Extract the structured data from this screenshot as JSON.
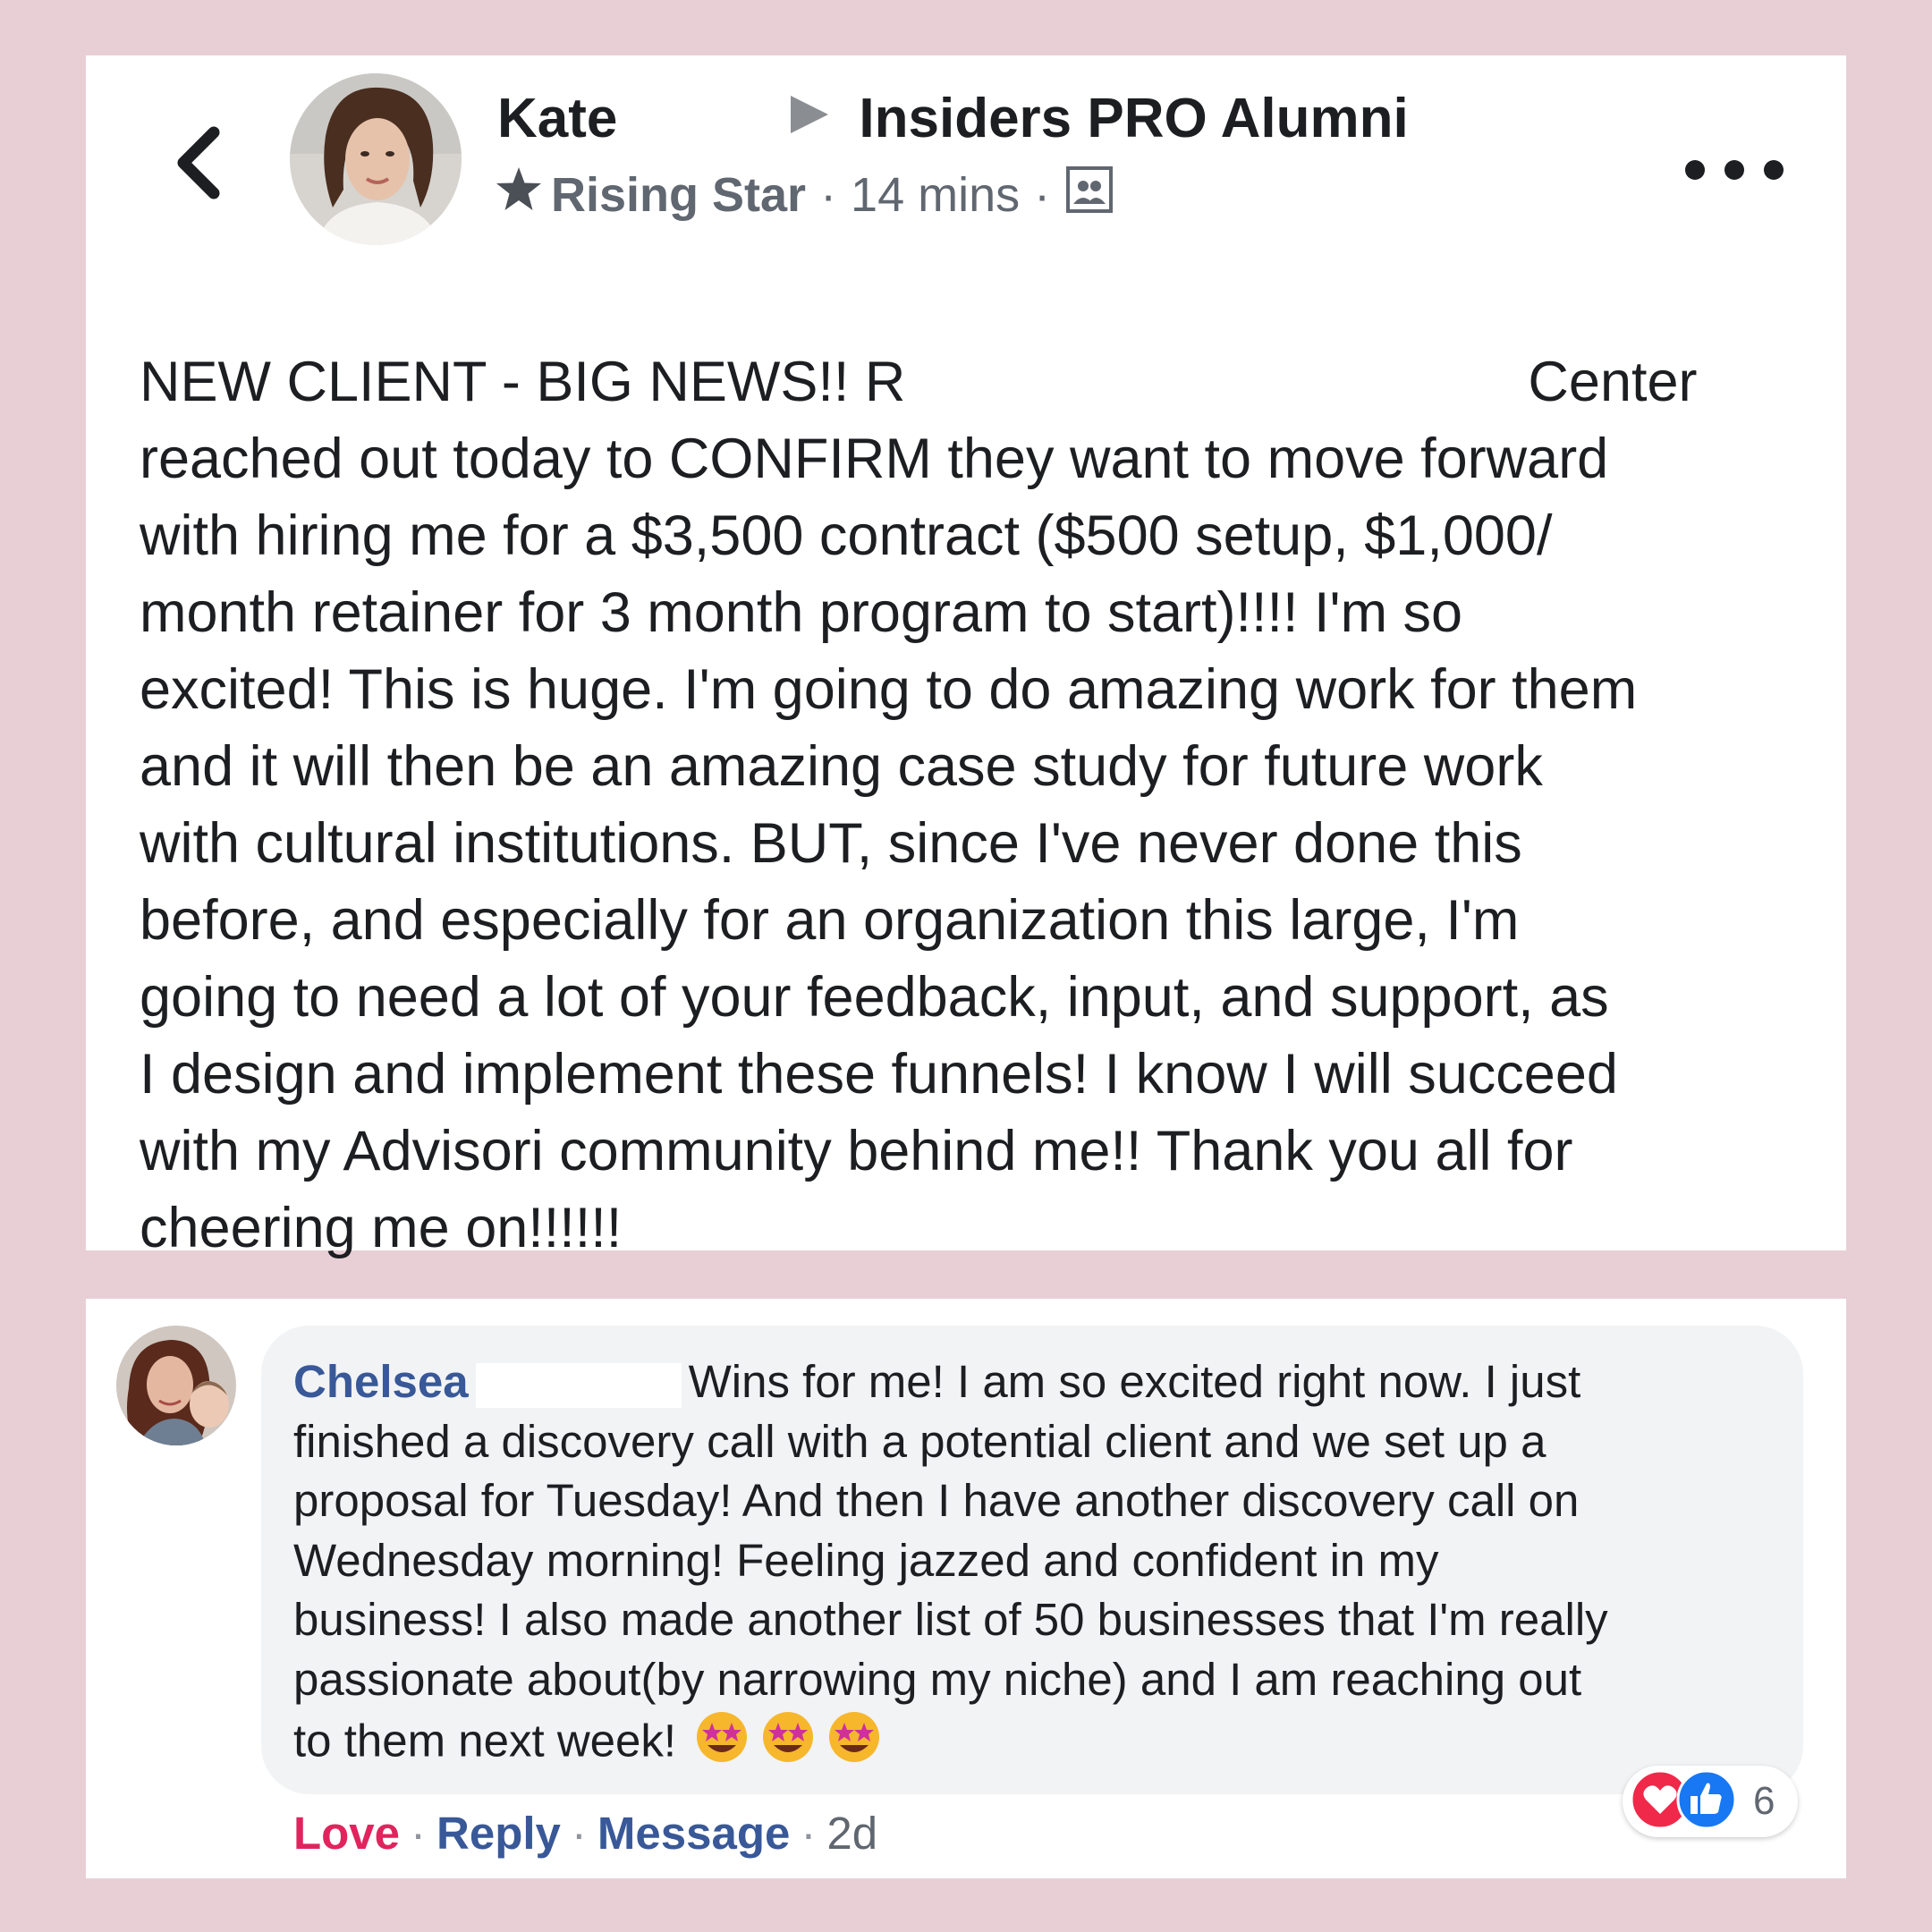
{
  "post": {
    "author_name": "Kate",
    "group_name": "Insiders PRO Alumni",
    "badge": "Rising Star",
    "time": "14 mins",
    "separator": "·",
    "lines": [
      {
        "before": "NEW CLIENT - BIG NEWS!! R",
        "after": "Center"
      },
      {
        "text": "reached out today to CONFIRM they want to move forward"
      },
      {
        "text": "with hiring me for a $3,500 contract ($500 setup, $1,000/"
      },
      {
        "text": "month retainer for 3 month program to start)!!!! I'm so"
      },
      {
        "text": "excited! This is huge. I'm going to do amazing work for them"
      },
      {
        "text": "and it will then be an amazing case study for future work"
      },
      {
        "text": "with cultural institutions. BUT, since I've never done this"
      },
      {
        "text": "before, and especially for an organization this large, I'm"
      },
      {
        "text": "going to need a lot of your feedback, input, and support, as"
      },
      {
        "text": "I design and implement these funnels! I know I will succeed"
      },
      {
        "text": "with my Advisori community behind me!! Thank you all for"
      },
      {
        "text": "cheering me on!!!!!!"
      }
    ]
  },
  "comment": {
    "author_name": "Chelsea",
    "first_line": "Wins for me! I am so excited right now. I just",
    "lines": [
      "finished a discovery call with a potential client and we set up a",
      "proposal for Tuesday! And then I have another discovery call on",
      "Wednesday morning! Feeling jazzed and confident in my",
      "business! I also made another list of 50 businesses that I'm really",
      "passionate about(by narrowing my niche) and I am reaching out"
    ],
    "last_line": "to them next week!",
    "emoji_icon": "star-struck-emoji",
    "actions": {
      "love": "Love",
      "reply": "Reply",
      "message": "Message",
      "time": "2d",
      "separator": "·"
    },
    "reaction_count": "6"
  },
  "colors": {
    "background": "#e8cfd6",
    "link_blue": "#385898",
    "love_red": "#e0245e",
    "text": "#1c1e21",
    "meta_gray": "#606770"
  }
}
